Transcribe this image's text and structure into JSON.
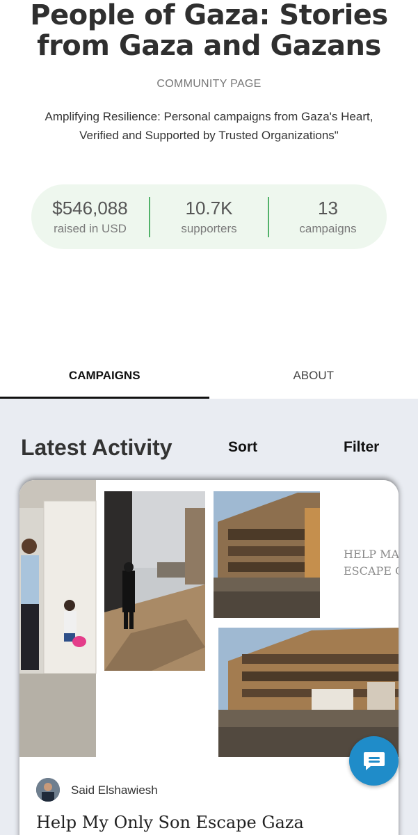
{
  "header": {
    "title_line1": "People of Gaza: Stories",
    "title_line2": "from Gaza and Gazans",
    "page_type": "COMMUNITY PAGE",
    "description": "Amplifying Resilience: Personal campaigns from Gaza's Heart, Verified and Supported by Trusted Organizations\""
  },
  "stats": {
    "raised_value": "$546,088",
    "raised_label": "raised in USD",
    "supporters_value": "10.7K",
    "supporters_label": "supporters",
    "campaigns_value": "13",
    "campaigns_label": "campaigns"
  },
  "tabs": {
    "campaigns": "CAMPAIGNS",
    "about": "ABOUT"
  },
  "activity": {
    "title": "Latest Activity",
    "sort_label": "Sort",
    "filter_label": "Filter"
  },
  "card": {
    "image_text_line1": "HELP MA",
    "image_text_line2": "ESCAPE G",
    "author": "Said Elshawiesh",
    "title": "Help My Only Son Escape Gaza"
  },
  "icons": {
    "chat": "chat-bubble-icon"
  },
  "colors": {
    "stats_bg": "#eef7ee",
    "divider_green": "#52b26a",
    "activity_bg": "#e9ecf2",
    "chat_blue": "#1f8cc9"
  }
}
